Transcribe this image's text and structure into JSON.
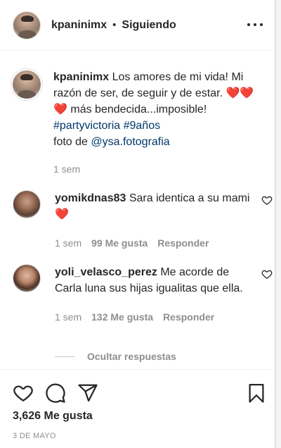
{
  "header": {
    "username": "kpaninimx",
    "separator": "•",
    "follow_status": "Siguiendo",
    "more_icon": "more-options-icon"
  },
  "caption": {
    "username": "kpaninimx",
    "text_part1": "Los amores de mi vida! Mi razón de ser, de seguir y de estar.",
    "hearts1": "❤️❤️",
    "hearts2": "❤️",
    "text_part2": "más bendecida...imposible!",
    "hashtag1": "#partyvictoria",
    "hashtag2": "#9años",
    "photo_credit_prefix": "foto de",
    "mention": "@ysa.fotografia",
    "time": "1 sem"
  },
  "comments": [
    {
      "username": "yomikdnas83",
      "text": "Sara identica a su mami",
      "emoji": "❤️",
      "time": "1 sem",
      "likes": "99 Me gusta",
      "reply": "Responder"
    },
    {
      "username": "yoli_velasco_perez",
      "text": "Me acorde de Carla luna sus hijas igualitas que ella.",
      "time": "1 sem",
      "likes": "132 Me gusta",
      "reply": "Responder"
    }
  ],
  "hide_replies": "Ocultar respuestas",
  "actions": {
    "likes_count": "3,626 Me gusta",
    "date": "3 DE MAYO",
    "icons": [
      "heart-icon",
      "comment-icon",
      "share-icon",
      "bookmark-icon"
    ]
  },
  "colors": {
    "text": "#262626",
    "muted": "#8e8e8e",
    "link": "#00376b",
    "heart_red": "#ed4956"
  }
}
